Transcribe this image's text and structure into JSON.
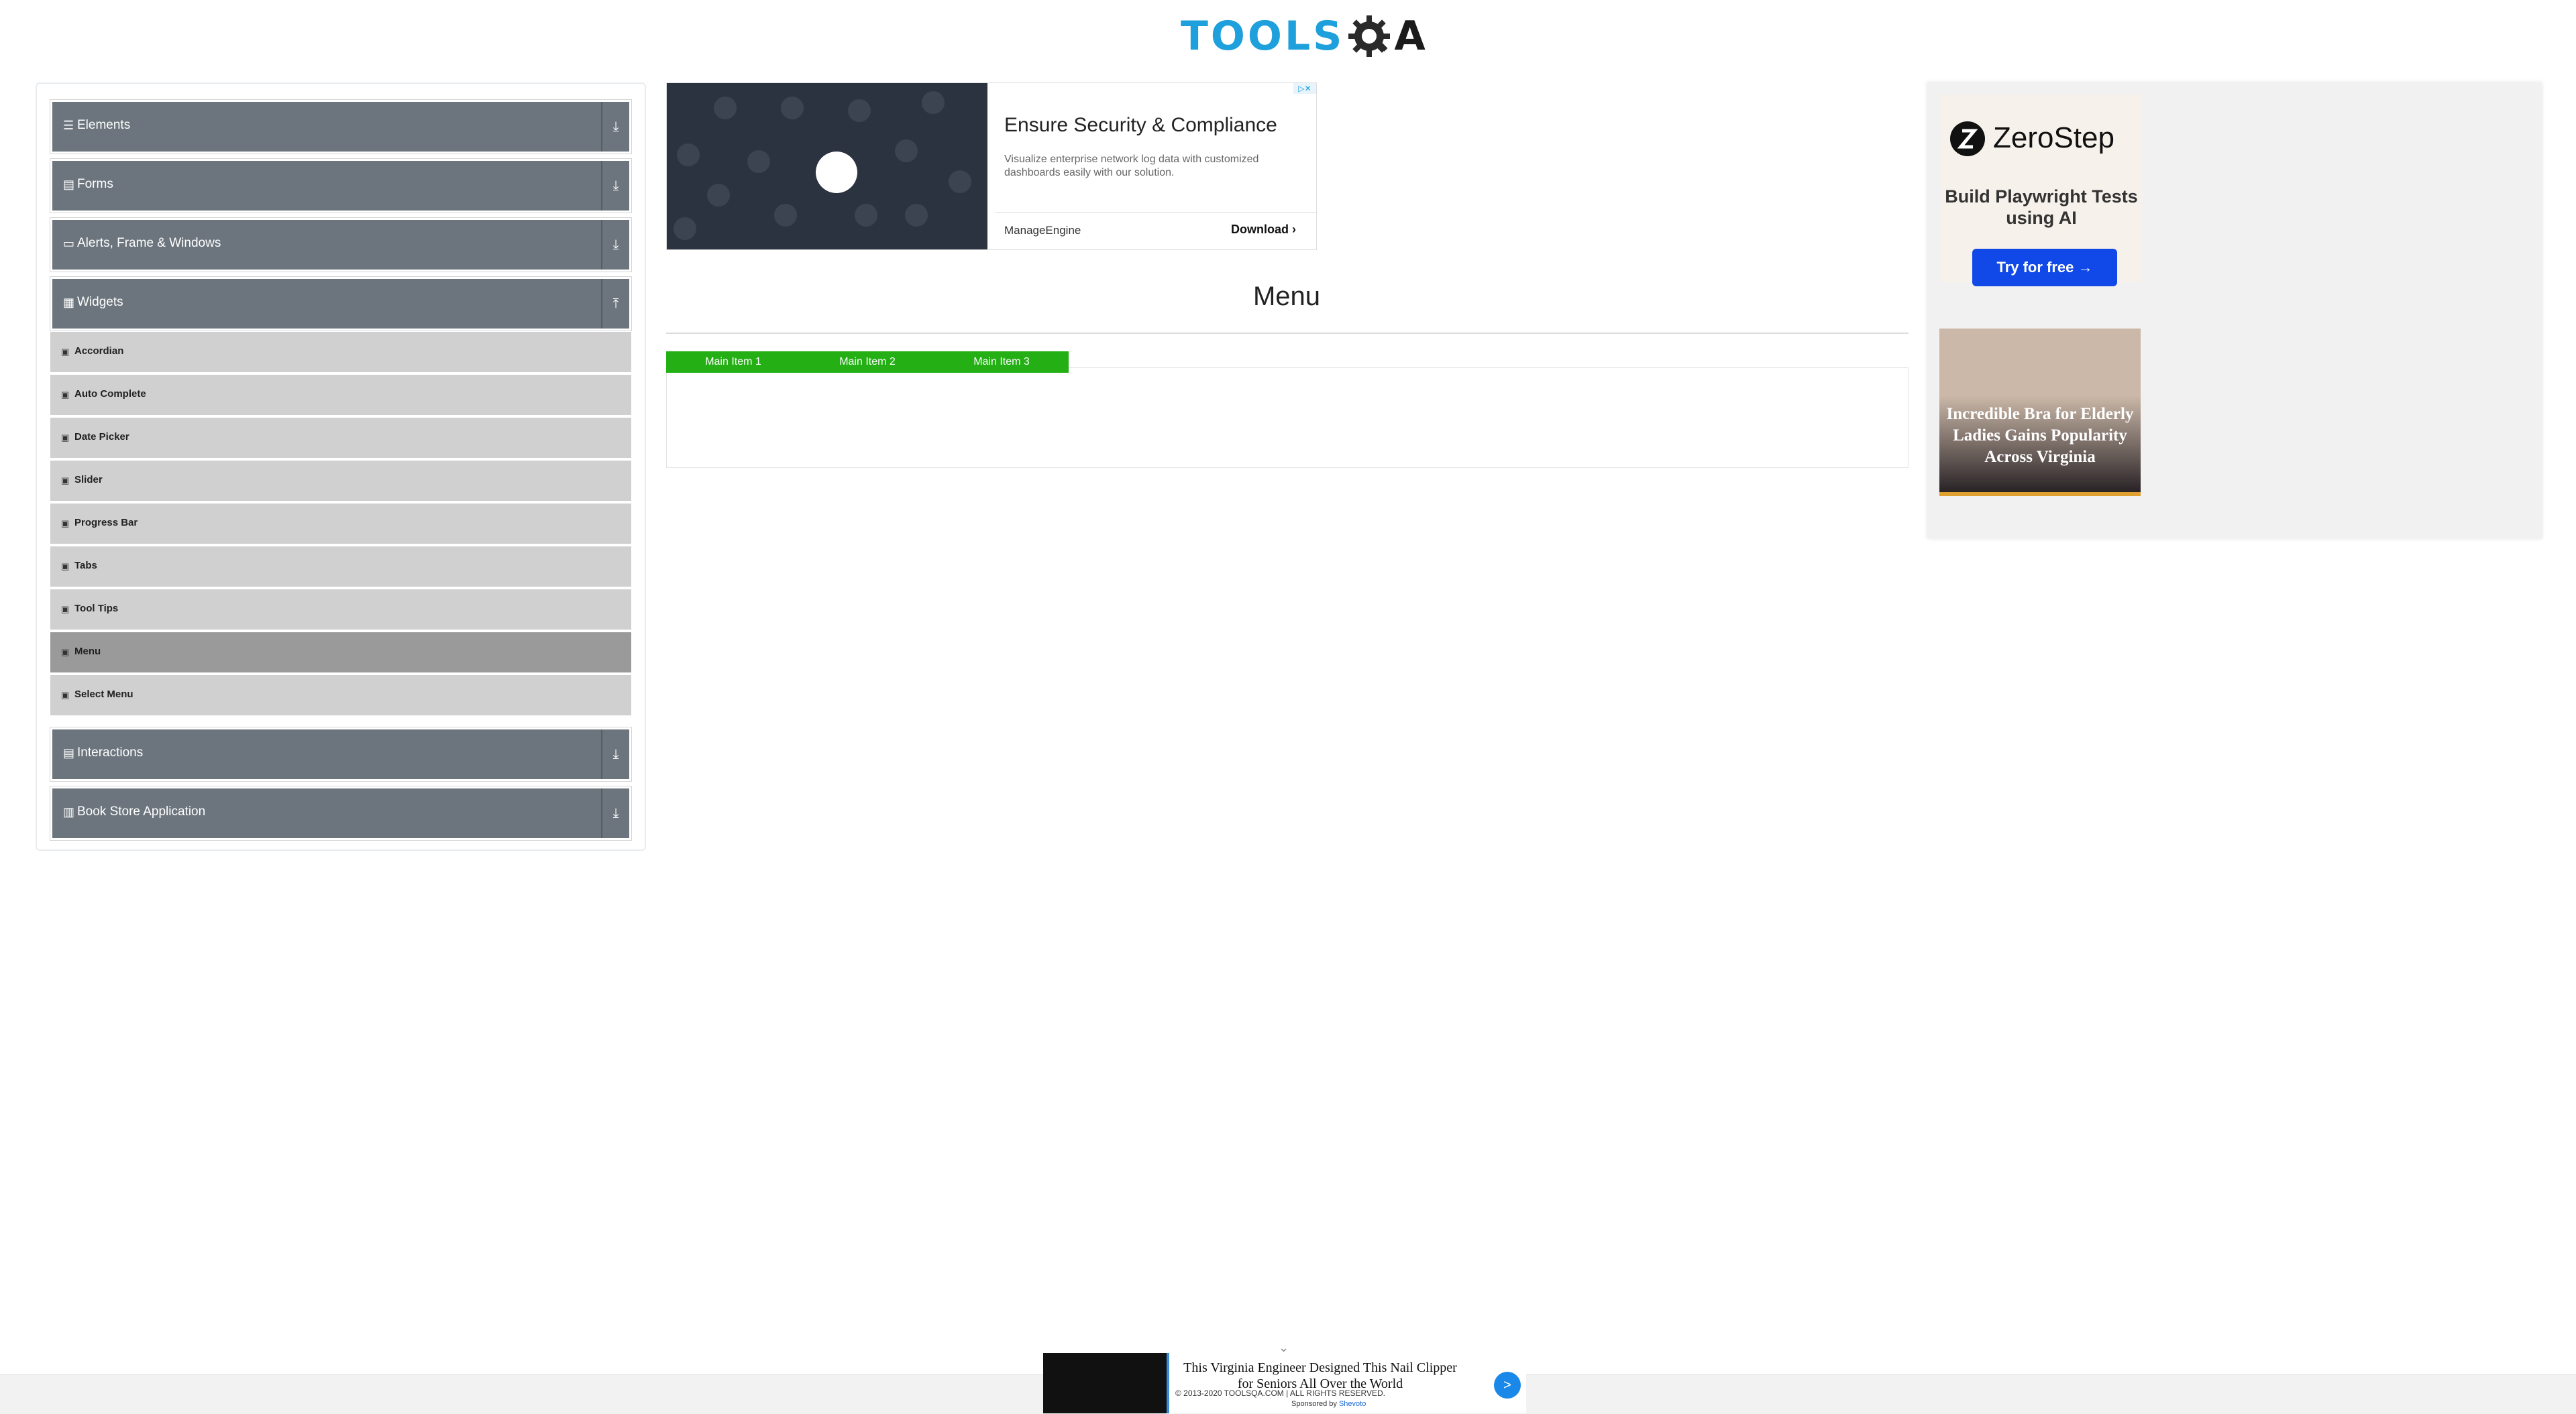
{
  "logo": {
    "text_left": "TOOLS",
    "text_right": "A"
  },
  "sidebar": {
    "groups": [
      {
        "label": "Elements",
        "icon": "list-icon",
        "toggle": "⤓"
      },
      {
        "label": "Forms",
        "icon": "form-icon",
        "toggle": "⤓"
      },
      {
        "label": "Alerts, Frame & Windows",
        "icon": "window-icon",
        "toggle": "⤓"
      },
      {
        "label": "Widgets",
        "icon": "widgets-icon",
        "toggle": "⤒"
      },
      {
        "label": "Interactions",
        "icon": "interactions-icon",
        "toggle": "⤓"
      },
      {
        "label": "Book Store Application",
        "icon": "book-icon",
        "toggle": "⤓"
      }
    ],
    "widget_items": [
      {
        "label": "Accordian"
      },
      {
        "label": "Auto Complete"
      },
      {
        "label": "Date Picker"
      },
      {
        "label": "Slider"
      },
      {
        "label": "Progress Bar"
      },
      {
        "label": "Tabs"
      },
      {
        "label": "Tool Tips"
      },
      {
        "label": "Menu",
        "active": true
      },
      {
        "label": "Select Menu"
      }
    ]
  },
  "ad_top": {
    "title": "Ensure Security & Compliance",
    "description": "Visualize enterprise network log data with customized dashboards easily with our solution.",
    "brand": "ManageEngine",
    "cta": "Download",
    "adchoices": "▷✕"
  },
  "page": {
    "title": "Menu"
  },
  "menu": {
    "items": [
      "Main Item 1",
      "Main Item 2",
      "Main Item 3"
    ]
  },
  "ad_right": {
    "zerostep": {
      "name": "ZeroStep",
      "tagline": "Build Playwright Tests using AI",
      "cta": "Try for free →"
    },
    "bra": {
      "headline": "Incredible Bra for Elderly Ladies Gains Popularity Across Virginia"
    }
  },
  "footer": {
    "copyright": "© 2013-2020 TOOLSQA.COM | ALL RIGHTS RESERVED.",
    "ad_text": "This Virginia Engineer Designed This Nail Clipper for Seniors All Over the World",
    "sponsored_by": "Sponsored by",
    "sponsor": "Shevoto",
    "go": ">",
    "chevron": "⌄"
  },
  "colors": {
    "sidebar_group": "#6c757d",
    "menu_green": "#24af15",
    "logo_blue": "#1ea0dc"
  }
}
